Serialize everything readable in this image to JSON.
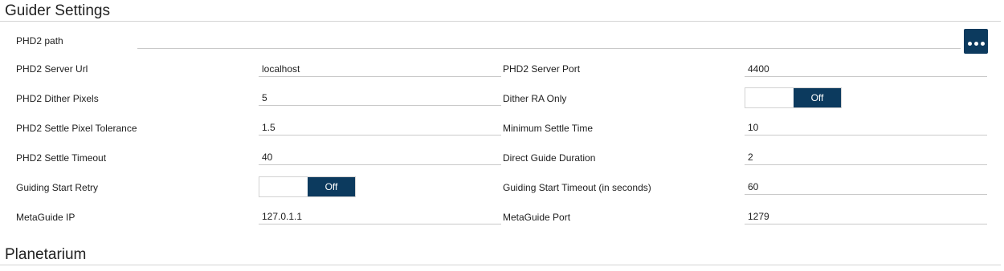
{
  "sections": {
    "guider_title": "Guider Settings",
    "planetarium_title": "Planetarium"
  },
  "phd2_path": {
    "label": "PHD2 path",
    "value": ""
  },
  "left": {
    "server_url": {
      "label": "PHD2 Server Url",
      "value": "localhost"
    },
    "dither_pixels": {
      "label": "PHD2 Dither Pixels",
      "value": "5"
    },
    "settle_tolerance": {
      "label": "PHD2 Settle Pixel Tolerance",
      "value": "1.5"
    },
    "settle_timeout": {
      "label": "PHD2 Settle Timeout",
      "value": "40"
    },
    "start_retry": {
      "label": "Guiding Start Retry",
      "state": "Off"
    },
    "metaguide_ip": {
      "label": "MetaGuide IP",
      "value": "127.0.1.1"
    }
  },
  "right": {
    "server_port": {
      "label": "PHD2 Server Port",
      "value": "4400"
    },
    "dither_ra_only": {
      "label": "Dither RA Only",
      "state": "Off"
    },
    "min_settle_time": {
      "label": "Minimum Settle Time",
      "value": "10"
    },
    "direct_guide_duration": {
      "label": "Direct Guide Duration",
      "value": "2"
    },
    "start_timeout": {
      "label": "Guiding Start Timeout (in seconds)",
      "value": "60"
    },
    "metaguide_port": {
      "label": "MetaGuide Port",
      "value": "1279"
    }
  },
  "colors": {
    "accent": "#0c3a5e",
    "rule": "#d4d4d4"
  },
  "icons": {
    "browse": "ellipsis-icon"
  }
}
